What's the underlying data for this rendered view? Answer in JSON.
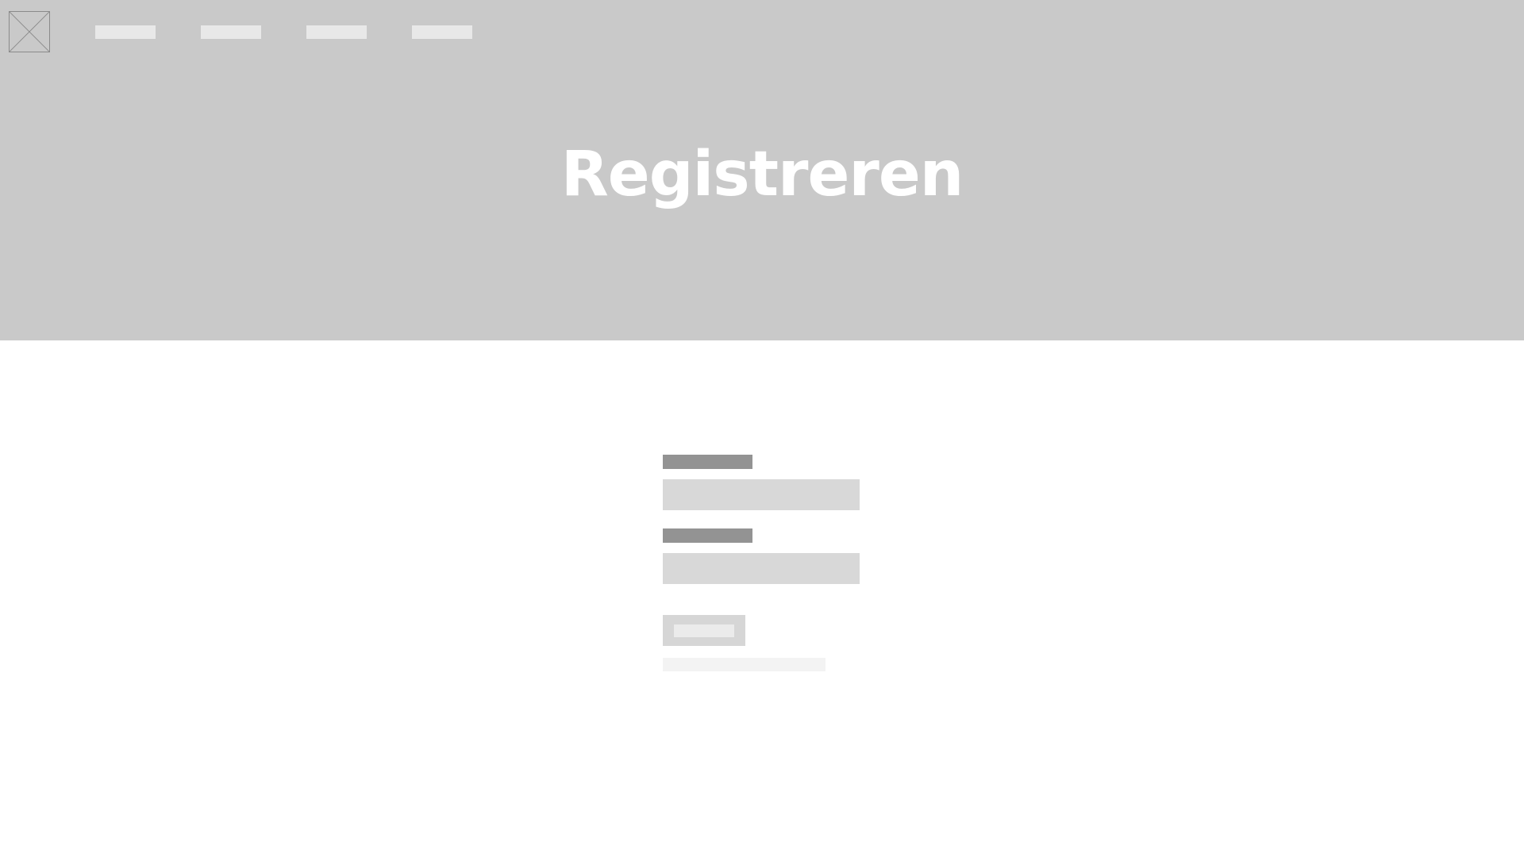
{
  "header": {
    "logo_icon": "image-placeholder-icon",
    "nav_items": [
      {
        "label": ""
      },
      {
        "label": ""
      },
      {
        "label": ""
      },
      {
        "label": ""
      }
    ]
  },
  "hero": {
    "title": "Registreren"
  },
  "form": {
    "fields": [
      {
        "label": "",
        "value": ""
      },
      {
        "label": "",
        "value": ""
      }
    ],
    "submit_label": "",
    "helper_link": ""
  },
  "colors": {
    "hero_background": "#c9c9c9",
    "title_text": "#ffffff",
    "label_placeholder": "#939393",
    "input_background": "#d8d8d8",
    "nav_placeholder": "#e8e8e8"
  }
}
